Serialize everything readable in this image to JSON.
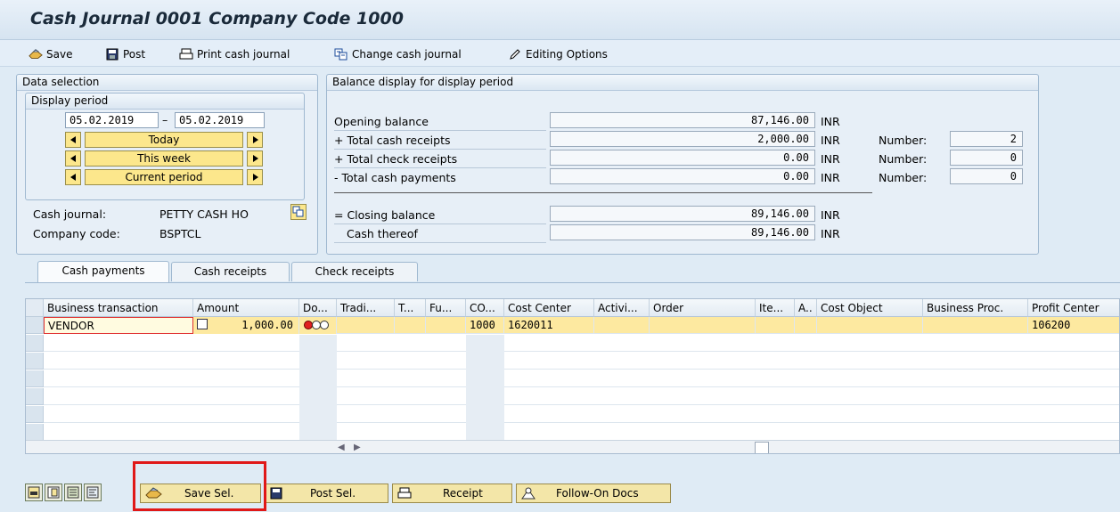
{
  "window": {
    "title": "Cash Journal 0001 Company Code 1000"
  },
  "toolbar": {
    "save": "Save",
    "post": "Post",
    "print": "Print cash journal",
    "change": "Change cash journal",
    "editing": "Editing Options"
  },
  "data_selection": {
    "header": "Data selection",
    "display_period": "Display period",
    "date_from": "05.02.2019",
    "date_to": "05.02.2019",
    "dash": "–",
    "today": "Today",
    "this_week": "This week",
    "current_period": "Current period",
    "cash_journal_label": "Cash journal:",
    "cash_journal_value": "PETTY CASH HO",
    "company_code_label": "Company code:",
    "company_code_value": "BSPTCL"
  },
  "balance": {
    "header": "Balance display for display period",
    "rows": [
      {
        "label": "Opening balance",
        "amount": "87,146.00",
        "currency": "INR"
      },
      {
        "label": "+ Total cash receipts",
        "amount": "2,000.00",
        "currency": "INR",
        "number_label": "Number:",
        "number": "2"
      },
      {
        "label": "+ Total check receipts",
        "amount": "0.00",
        "currency": "INR",
        "number_label": "Number:",
        "number": "0"
      },
      {
        "label": "- Total cash payments",
        "amount": "0.00",
        "currency": "INR",
        "number_label": "Number:",
        "number": "0"
      },
      {
        "label": "= Closing balance",
        "amount": "89,146.00",
        "currency": "INR"
      },
      {
        "label": "Cash thereof",
        "amount": "89,146.00",
        "currency": "INR"
      }
    ]
  },
  "tabs": [
    "Cash payments",
    "Cash receipts",
    "Check receipts"
  ],
  "table": {
    "columns": [
      "Business transaction",
      "Amount",
      "Do...",
      "Tradi...",
      "T...",
      "Fu...",
      "CO...",
      "Cost Center",
      "Activi...",
      "Order",
      "Ite...",
      "A..",
      "Cost Object",
      "Business Proc.",
      "Profit Center"
    ],
    "row": {
      "business_transaction": "VENDOR",
      "amount": "1,000.00",
      "co": "1000",
      "cost_center": "1620011",
      "profit_center": "106200"
    }
  },
  "bottom": {
    "save_sel": "Save Sel.",
    "post_sel": "Post Sel.",
    "receipt": "Receipt",
    "follow_on": "Follow-On Docs"
  },
  "colors": {
    "highlight_box": "#e01818",
    "row_selected": "#fde9a0",
    "button_yellow": "#fce78c"
  }
}
